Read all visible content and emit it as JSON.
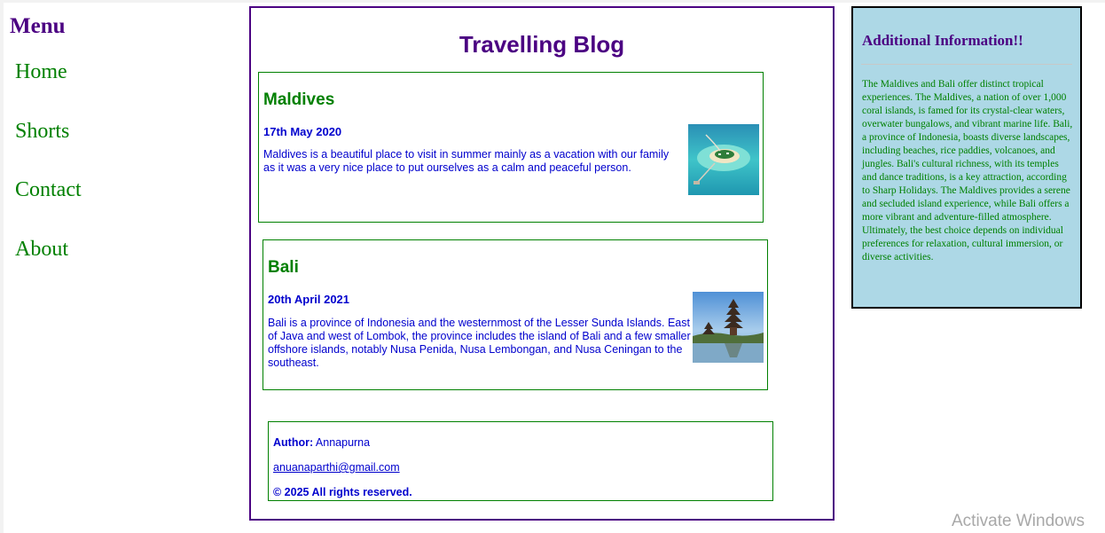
{
  "menu": {
    "title": "Menu",
    "items": [
      {
        "label": "Home"
      },
      {
        "label": "Shorts"
      },
      {
        "label": "Contact"
      },
      {
        "label": "About"
      }
    ]
  },
  "main": {
    "title": "Travelling Blog",
    "posts": [
      {
        "title": "Maldives",
        "date": "17th May 2020",
        "body": "Maldives is a beautiful place to visit in summer mainly as a vacation with our family as it was a very nice place to put ourselves as a calm and peaceful person."
      },
      {
        "title": "Bali",
        "date": "20th April 2021",
        "body": "Bali is a province of Indonesia and the westernmost of the Lesser Sunda Islands. East of Java and west of Lombok, the province includes the island of Bali and a few smaller offshore islands, notably Nusa Penida, Nusa Lembongan, and Nusa Ceningan to the southeast."
      }
    ],
    "footer": {
      "author_label": "Author:",
      "author_name": "Annapurna",
      "email": "anuanaparthi@gmail.com",
      "copyright": "© 2025 All rights reserved."
    }
  },
  "info": {
    "title": "Additional Information!!",
    "text": "The Maldives and Bali offer distinct tropical experiences. The Maldives, a nation of over 1,000 coral islands, is famed for its crystal-clear waters, overwater bungalows, and vibrant marine life. Bali, a province of Indonesia, boasts diverse landscapes, including beaches, rice paddies, volcanoes, and jungles. Bali's cultural richness, with its temples and dance traditions, is a key attraction, according to Sharp Holidays. The Maldives provides a serene and secluded island experience, while Bali offers a more vibrant and adventure-filled atmosphere. Ultimately, the best choice depends on individual preferences for relaxation, cultural immersion, or diverse activities."
  },
  "system": {
    "watermark": "Activate Windows"
  },
  "colors": {
    "accent_purple": "#4b0082",
    "accent_green": "#008000",
    "text_blue": "#0000cd",
    "info_bg": "#add8e6"
  }
}
